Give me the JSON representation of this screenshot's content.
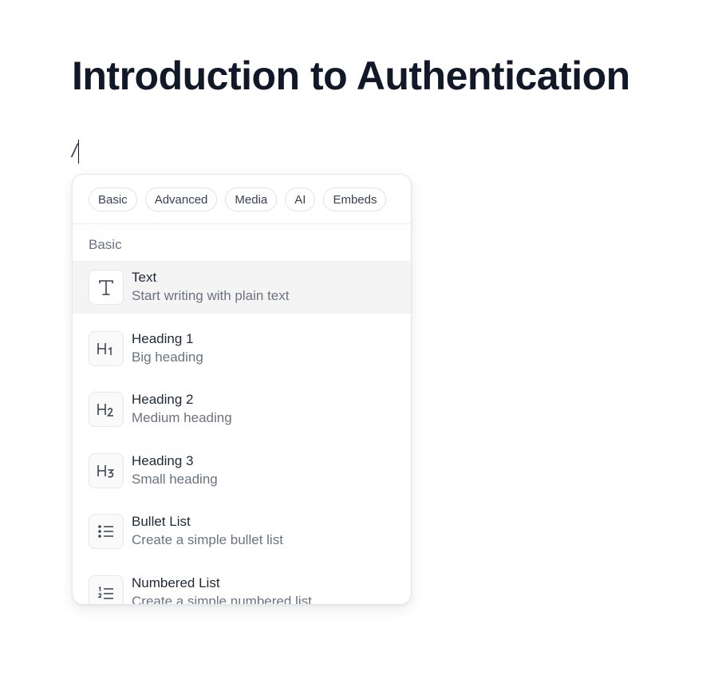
{
  "document": {
    "title": "Introduction to Authentication",
    "current_line": "/"
  },
  "slash_menu": {
    "tabs": [
      "Basic",
      "Advanced",
      "Media",
      "AI",
      "Embeds"
    ],
    "section_label": "Basic",
    "items": [
      {
        "icon": "text-icon",
        "title": "Text",
        "description": "Start writing with plain text",
        "active": true
      },
      {
        "icon": "heading-1-icon",
        "title": "Heading 1",
        "description": "Big heading"
      },
      {
        "icon": "heading-2-icon",
        "title": "Heading 2",
        "description": "Medium heading"
      },
      {
        "icon": "heading-3-icon",
        "title": "Heading 3",
        "description": "Small heading"
      },
      {
        "icon": "bullet-list-icon",
        "title": "Bullet List",
        "description": "Create a simple bullet list"
      },
      {
        "icon": "numbered-list-icon",
        "title": "Numbered List",
        "description": "Create a simple numbered list"
      }
    ]
  },
  "colors": {
    "title": "#111827",
    "active_row": "#f4f4f5",
    "muted_text": "#6b7280"
  }
}
